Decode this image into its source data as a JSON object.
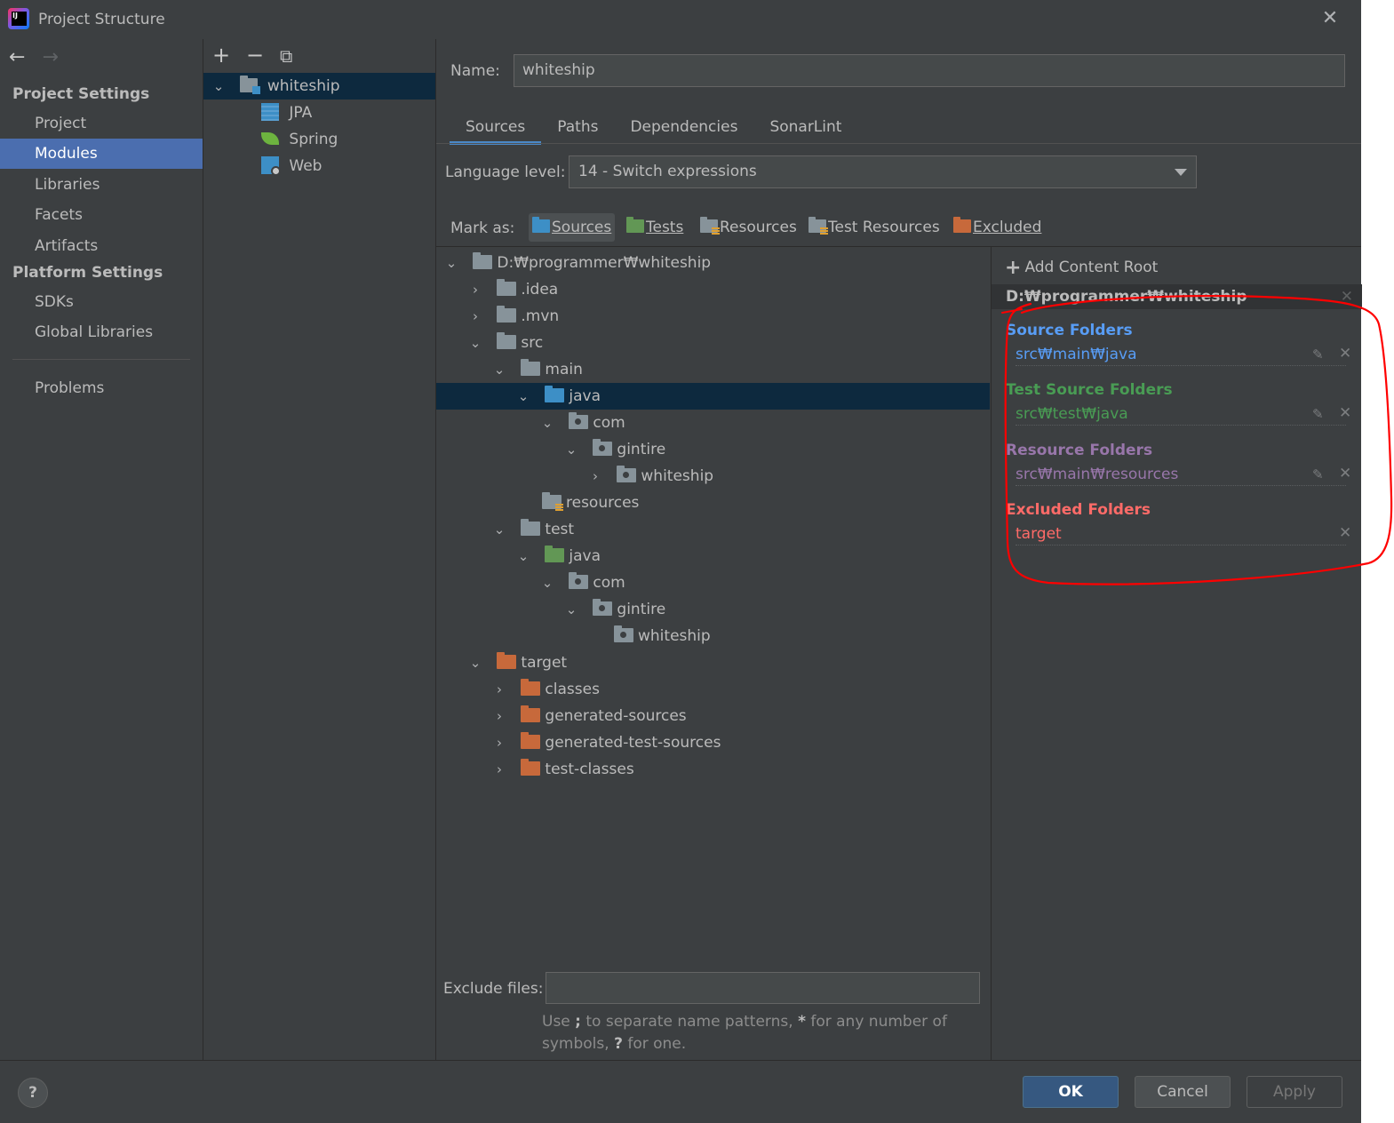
{
  "window": {
    "title": "Project Structure",
    "close_label": "✕"
  },
  "nav": {
    "back": "←",
    "forward": "→",
    "project_settings": "Project Settings",
    "platform_settings": "Platform Settings",
    "items": [
      {
        "label": "Project"
      },
      {
        "label": "Modules",
        "selected": true
      },
      {
        "label": "Libraries"
      },
      {
        "label": "Facets"
      },
      {
        "label": "Artifacts"
      }
    ],
    "platform_items": [
      {
        "label": "SDKs"
      },
      {
        "label": "Global Libraries"
      }
    ],
    "problems": "Problems"
  },
  "modules": {
    "toolbar": {
      "add": "+",
      "remove": "−",
      "copy": "⧉"
    },
    "root": "whiteship",
    "children": [
      "JPA",
      "Spring",
      "Web"
    ]
  },
  "main": {
    "name_label": "Name:",
    "name_value": "whiteship",
    "tabs": [
      "Sources",
      "Paths",
      "Dependencies",
      "SonarLint"
    ],
    "active_tab": "Sources",
    "language_label": "Language level:",
    "language_value": "14 - Switch expressions",
    "mark_as_label": "Mark as:",
    "mark_buttons": [
      {
        "label": "Sources",
        "color": "#3d8fc6"
      },
      {
        "label": "Tests",
        "color": "#629755"
      },
      {
        "label": "Resources",
        "color": "#87939a"
      },
      {
        "label": "Test Resources",
        "color": "#87939a"
      },
      {
        "label": "Excluded",
        "color": "#c7693b"
      }
    ]
  },
  "tree": [
    {
      "label": "D:₩programmer₩whiteship",
      "depth": 0,
      "expanded": true
    },
    {
      "label": ".idea",
      "depth": 1,
      "expanded": false
    },
    {
      "label": ".mvn",
      "depth": 1,
      "expanded": false
    },
    {
      "label": "src",
      "depth": 1,
      "expanded": true
    },
    {
      "label": "main",
      "depth": 2,
      "expanded": true
    },
    {
      "label": "java",
      "depth": 3,
      "expanded": true,
      "selected": true
    },
    {
      "label": "com",
      "depth": 4,
      "expanded": true
    },
    {
      "label": "gintire",
      "depth": 5,
      "expanded": true
    },
    {
      "label": "whiteship",
      "depth": 6,
      "expanded": false
    },
    {
      "label": "resources",
      "depth": 3
    },
    {
      "label": "test",
      "depth": 2,
      "expanded": true
    },
    {
      "label": "java",
      "depth": 3,
      "expanded": true
    },
    {
      "label": "com",
      "depth": 4,
      "expanded": true
    },
    {
      "label": "gintire",
      "depth": 5,
      "expanded": true
    },
    {
      "label": "whiteship",
      "depth": 6
    },
    {
      "label": "target",
      "depth": 1,
      "expanded": true
    },
    {
      "label": "classes",
      "depth": 2,
      "expanded": false
    },
    {
      "label": "generated-sources",
      "depth": 2,
      "expanded": false
    },
    {
      "label": "generated-test-sources",
      "depth": 2,
      "expanded": false
    },
    {
      "label": "test-classes",
      "depth": 2,
      "expanded": false
    }
  ],
  "exclude": {
    "label": "Exclude files:",
    "value": "",
    "hint_1": "Use ",
    "hint_sep": ";",
    "hint_2": " to separate name patterns, ",
    "hint_star": "*",
    "hint_3": " for any number of symbols, ",
    "hint_q": "?",
    "hint_4": " for one."
  },
  "content_root": {
    "add_label": "Add Content Root",
    "root_path": "D:₩programmer₩whiteship",
    "sections": [
      {
        "title": "Source Folders",
        "path": "src₩main₩java",
        "color": "#589df6",
        "editable": true
      },
      {
        "title": "Test Source Folders",
        "path": "src₩test₩java",
        "color": "#499c54",
        "editable": true
      },
      {
        "title": "Resource Folders",
        "path": "src₩main₩resources",
        "color": "#9876aa",
        "editable": true
      },
      {
        "title": "Excluded Folders",
        "path": "target",
        "color": "#ff6b68",
        "editable": false
      }
    ]
  },
  "buttons": {
    "help": "?",
    "ok": "OK",
    "cancel": "Cancel",
    "apply": "Apply"
  },
  "annotation_color": "#ff0000"
}
